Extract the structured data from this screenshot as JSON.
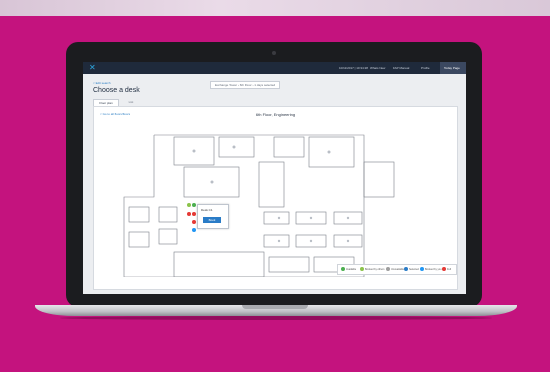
{
  "app": {
    "logo_label": "",
    "header": {
      "date_time": "10/11/2017 | 10:34:28",
      "links": [
        "Whats New",
        "FAP Manual",
        "Profile",
        "Today Page"
      ],
      "active_link": "Today Page"
    }
  },
  "page": {
    "back_label": "< Edit search",
    "title": "Choose a desk",
    "steps": "Exchange Tower  ›  6th Floor  ›  1 days selected",
    "tabs": [
      "Floor plan",
      "List"
    ],
    "active_tab": "Floor plan"
  },
  "floor_plan": {
    "back_label": "< Go to all floors/floors",
    "title": "6th Floor, Engineering",
    "popup": {
      "desk_label": "Desk C1",
      "button_label": "Book"
    }
  },
  "legend": [
    {
      "label": "Available",
      "color": "#4caf50"
    },
    {
      "label": "Booked by others",
      "color": "#8bc34a"
    },
    {
      "label": "Unavailable",
      "color": "#9e9e9e"
    },
    {
      "label": "Selected",
      "color": "#2a7cc7"
    },
    {
      "label": "Booked by you",
      "color": "#2196f3"
    },
    {
      "label": "Full",
      "color": "#e53935"
    }
  ],
  "colors": {
    "background": "#c4137e",
    "header": "#1f2a3b",
    "accent": "#2a7cc7"
  }
}
